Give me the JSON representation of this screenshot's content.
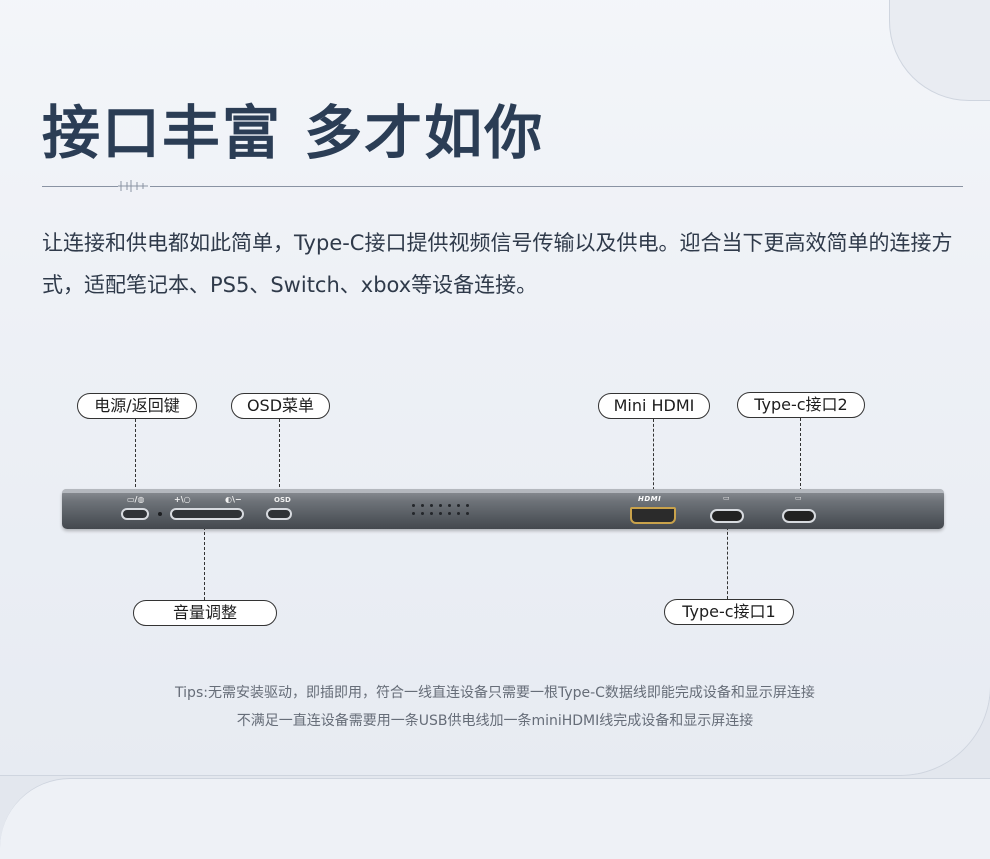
{
  "title": "接口丰富 多才如你",
  "intro": "让连接和供电都如此简单，Type-C接口提供视频信号传输以及供电。迎合当下更高效简单的连接方式，适配笔记本、PS5、Switch、xbox等设备连接。",
  "callouts": {
    "power_back": "电源/返回键",
    "osd_menu": "OSD菜单",
    "volume": "音量调整",
    "mini_hdmi": "Mini HDMI",
    "typec_2": "Type-c接口2",
    "typec_1": "Type-c接口1"
  },
  "device": {
    "power_label": "▭/◍",
    "volume_plus_label": "+\\○",
    "volume_minus_label": "◐\\−",
    "osd_label": "OSD",
    "hdmi_label": "HDMI",
    "typec_icon": "▭"
  },
  "tips": {
    "line1": "Tips:无需安装驱动，即插即用，符合一线直连设备只需要一根Type-C数据线即能完成设备和显示屏连接",
    "line2": "不满足一直连设备需要用一条USB供电线加一条miniHDMI线完成设备和显示屏连接"
  },
  "colors": {
    "title": "#2b3d55",
    "background": "#eef1f6",
    "device_body": "#5b6066",
    "hdmi_accent": "#c9a24b"
  }
}
